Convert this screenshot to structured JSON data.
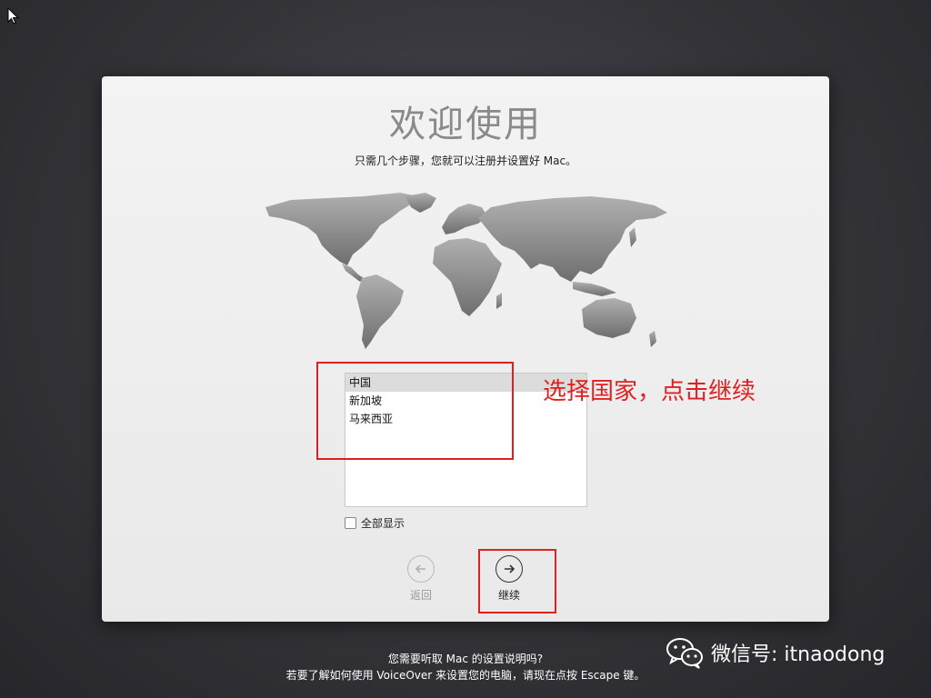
{
  "window": {
    "title": "欢迎使用",
    "subtitle": "只需几个步骤，您就可以注册并设置好 Mac。"
  },
  "country_list": {
    "items": [
      {
        "label": "中国",
        "selected": true
      },
      {
        "label": "新加坡",
        "selected": false
      },
      {
        "label": "马来西亚",
        "selected": false
      }
    ]
  },
  "show_all": {
    "label": "全部显示",
    "checked": false
  },
  "nav": {
    "back_label": "返回",
    "continue_label": "继续"
  },
  "annotation": {
    "text": "选择国家，点击继续",
    "color": "#e02020"
  },
  "footer": {
    "line1": "您需要听取 Mac 的设置说明吗?",
    "line2": "若要了解如何使用 VoiceOver 来设置您的电脑，请现在点按 Escape 键。"
  },
  "watermark": {
    "text": "微信号: itnaodong",
    "icon": "wechat-icon"
  }
}
